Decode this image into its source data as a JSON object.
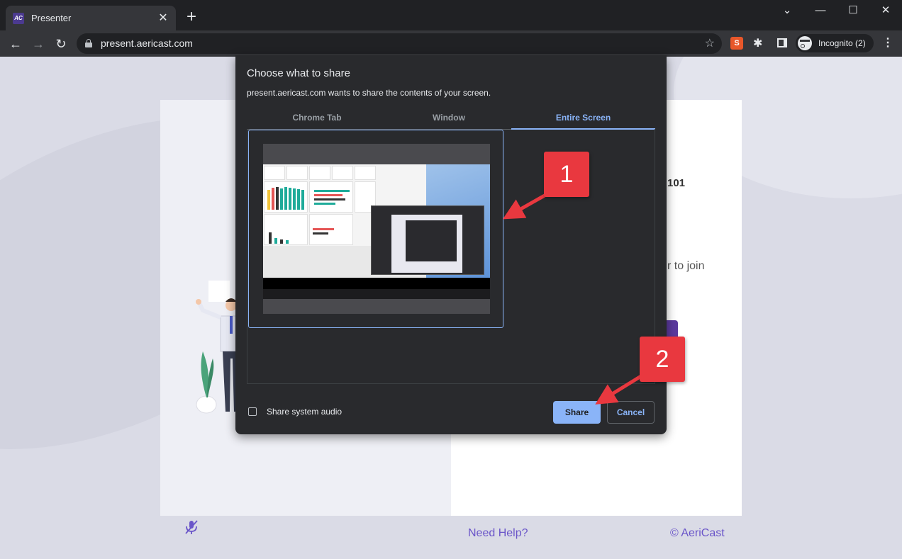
{
  "browser": {
    "tab_title": "Presenter",
    "favicon_text": "AC",
    "url": "present.aericast.com",
    "profile_label": "Incognito (2)",
    "extension_badge": "S"
  },
  "page": {
    "heading_fragment": "101",
    "text_fragment": "r to join",
    "need_help": "Need Help?",
    "copyright": "© AeriCast",
    "accent_color": "#6a55c9"
  },
  "dialog": {
    "title": "Choose what to share",
    "subtitle": "present.aericast.com wants to share the contents of your screen.",
    "tabs": [
      {
        "label": "Chrome Tab",
        "active": false
      },
      {
        "label": "Window",
        "active": false
      },
      {
        "label": "Entire Screen",
        "active": true
      }
    ],
    "audio_label": "Share system audio",
    "audio_checked": false,
    "share_label": "Share",
    "cancel_label": "Cancel",
    "accent_color": "#8ab4f8"
  },
  "callouts": [
    {
      "label": "1",
      "color": "#e9383f"
    },
    {
      "label": "2",
      "color": "#e9383f"
    }
  ]
}
